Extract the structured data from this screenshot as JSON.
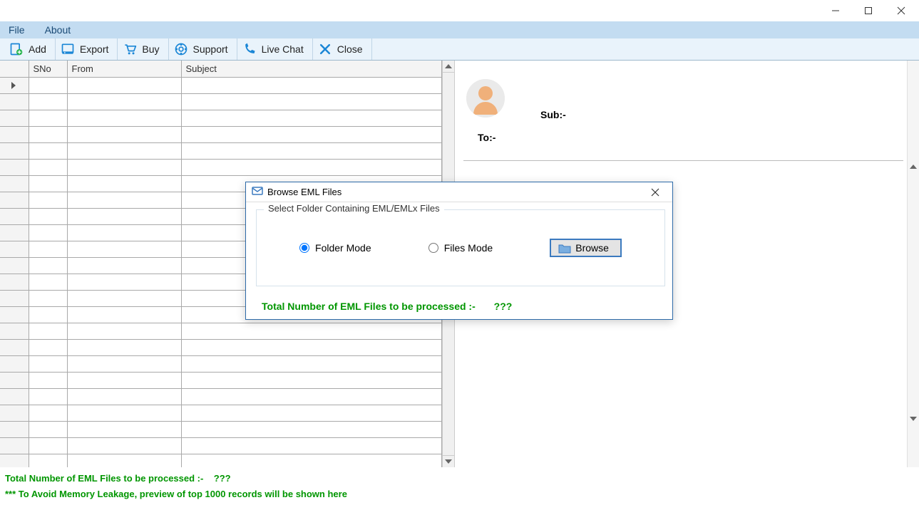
{
  "window": {
    "minimize": "–",
    "maximize": "▢",
    "close": "✕"
  },
  "menu": {
    "file": "File",
    "about": "About"
  },
  "toolbar": {
    "add": "Add",
    "export": "Export",
    "buy": "Buy",
    "support": "Support",
    "livechat": "Live Chat",
    "close": "Close"
  },
  "grid": {
    "headers": {
      "sno": "SNo",
      "from": "From",
      "subject": "Subject"
    },
    "row_count": 24
  },
  "preview": {
    "sub_label": "Sub:-",
    "to_label": "To:-"
  },
  "status": {
    "line1_prefix": "Total Number of EML Files to be processed :-",
    "line1_value": "???",
    "line2": "*** To Avoid Memory Leakage, preview of top 1000 records will be shown here"
  },
  "dialog": {
    "title": "Browse EML Files",
    "group_label": "Select Folder Containing EML/EMLx Files",
    "folder_mode": "Folder Mode",
    "files_mode": "Files Mode",
    "browse": "Browse",
    "status_prefix": "Total Number of EML Files to be processed :-",
    "status_value": "???",
    "selected_mode": "folder"
  }
}
